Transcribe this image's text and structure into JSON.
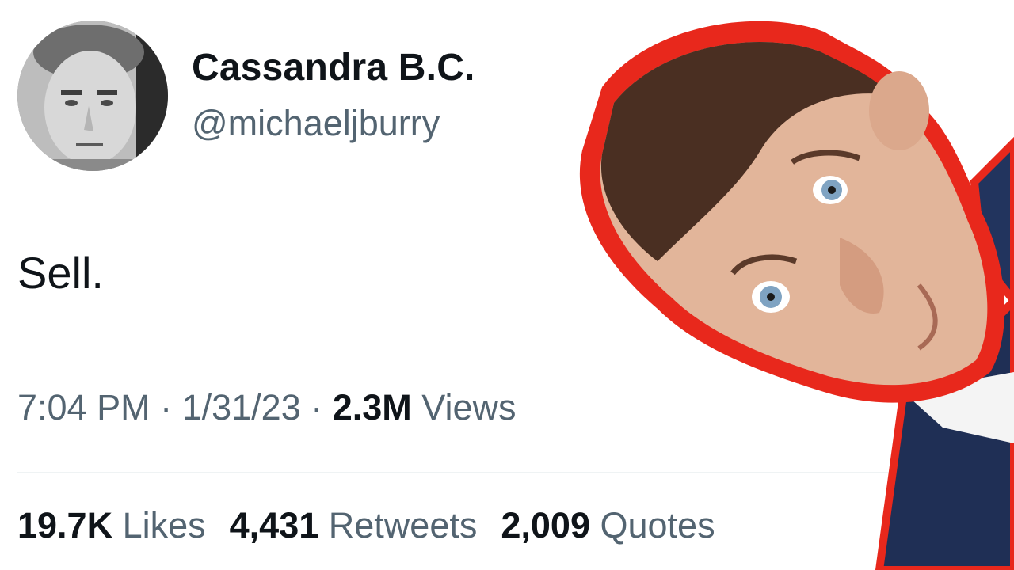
{
  "tweet": {
    "display_name": "Cassandra B.C.",
    "handle": "@michaeljburry",
    "text": "Sell.",
    "time": "7:04 PM",
    "separator": " · ",
    "date": "1/31/23",
    "views_count": "2.3M",
    "views_label": " Views",
    "likes_count": "19.7K",
    "likes_label": " Likes",
    "retweets_count": "4,431",
    "retweets_label": " Retweets",
    "quotes_count": "2,009",
    "quotes_label": " Quotes"
  },
  "colors": {
    "primary_text": "#0f1419",
    "secondary_text": "#536471",
    "divider": "#eff3f4",
    "sticker_outline": "#e8281c"
  },
  "icons": {
    "avatar": "profile-photo",
    "overlay": "person-sticker"
  }
}
